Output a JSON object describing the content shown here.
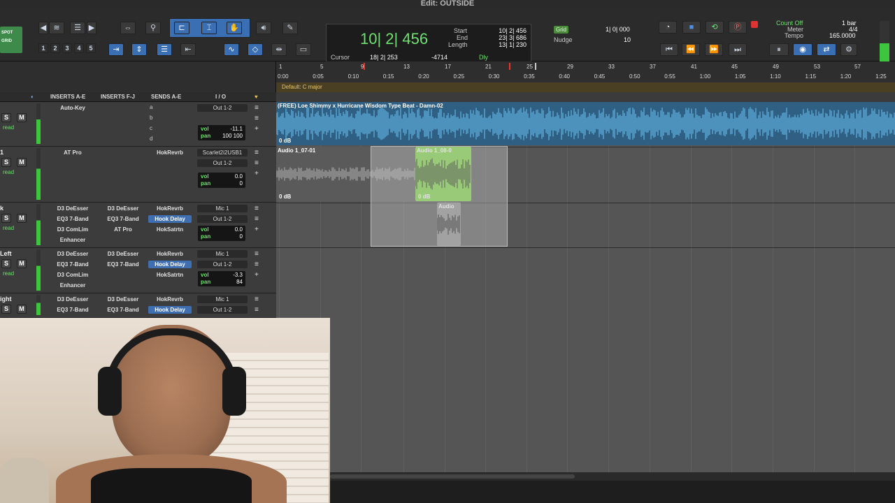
{
  "window": {
    "title": "Edit: OUTSIDE"
  },
  "toolbar": {
    "mode_spot": "SPOT",
    "mode_grid": "GRID",
    "zoom_presets": [
      "1",
      "2",
      "3",
      "4",
      "5"
    ]
  },
  "counter": {
    "main": "10| 2| 456",
    "start_label": "Start",
    "start_value": "10| 2| 456",
    "end_label": "End",
    "end_value": "23| 3| 686",
    "length_label": "Length",
    "length_value": "13| 1| 230",
    "cursor_label": "Cursor",
    "cursor_value": "18| 2| 253",
    "cursor_db": "-4714",
    "dly_label": "Dly"
  },
  "grid": {
    "label": "Grid",
    "value": "1| 0| 000",
    "nudge_label": "Nudge",
    "nudge_value": "10"
  },
  "meter": {
    "count_off": "Count Off",
    "meter_label": "Meter",
    "tempo_label": "Tempo",
    "bar": "1 bar",
    "sig": "4/4",
    "tempo": "165.0000"
  },
  "ruler": {
    "bars": [
      "1",
      "5",
      "9",
      "13",
      "17",
      "21",
      "25",
      "29",
      "33",
      "37",
      "41",
      "45",
      "49",
      "53",
      "57"
    ],
    "times": [
      "0:00",
      "0:05",
      "0:10",
      "0:15",
      "0:20",
      "0:25",
      "0:30",
      "0:35",
      "0:40",
      "0:45",
      "0:50",
      "0:55",
      "1:00",
      "1:05",
      "1:10",
      "1:15",
      "1:20",
      "1:25"
    ],
    "key": "Default: C major"
  },
  "columns": {
    "inserts_ae": "INSERTS A-E",
    "inserts_fj": "INSERTS F-J",
    "sends_ae": "SENDS A-E",
    "io": "I / O"
  },
  "mix_rows": [
    {
      "name": "",
      "ins_a": [
        "Auto-Key"
      ],
      "ins_b": [],
      "send": [
        "a",
        "b",
        "c",
        "d"
      ],
      "io": [
        "Out 1-2"
      ],
      "vol": "-11.1",
      "pan": "100  100",
      "rec": "read"
    },
    {
      "name": "1",
      "ins_a": [
        "AT Pro"
      ],
      "ins_b": [],
      "send_names": [
        "HokRevrb"
      ],
      "io": [
        "Scarlet2i2USB1",
        "Out 1-2"
      ],
      "vol": "0.0",
      "pan": "0",
      "rec": "read"
    },
    {
      "name": "k",
      "ins_a": [
        "D3 DeEsser",
        "EQ3 7-Band",
        "D3 ComLim",
        "Enhancer"
      ],
      "ins_b": [
        "D3 DeEsser",
        "EQ3 7-Band",
        "AT Pro"
      ],
      "send_names": [
        "HokRevrb",
        "Hook Delay",
        "HokSatrtn"
      ],
      "io": [
        "Mic 1",
        "Out 1-2"
      ],
      "vol": "0.0",
      "pan": "0",
      "rec": "read"
    },
    {
      "name": "Left",
      "ins_a": [
        "D3 DeEsser",
        "EQ3 7-Band",
        "D3 ComLim",
        "Enhancer"
      ],
      "ins_b": [
        "D3 DeEsser",
        "EQ3 7-Band"
      ],
      "send_names": [
        "HokRevrb",
        "Hook Delay",
        "HokSatrtn"
      ],
      "io": [
        "Mic 1",
        "Out 1-2"
      ],
      "vol": "-3.3",
      "pan": "84",
      "rec": "read"
    },
    {
      "name": "ight",
      "ins_a": [
        "D3 DeEsser",
        "EQ3 7-Band"
      ],
      "ins_b": [
        "D3 DeEsser",
        "EQ3 7-Band"
      ],
      "send_names": [
        "HokRevrb",
        "Hook Delay"
      ],
      "io": [
        "Mic 1",
        "Out 1-2"
      ],
      "vol": "",
      "pan": "",
      "rec": ""
    }
  ],
  "clips": {
    "beat": "(FREE) Loe Shimmy x Hurricane Wisdom Type Beat - Damn-02",
    "audio1": "Audio 1_07-01",
    "audio2": "Audio 1_08-0",
    "audio3": "Audio",
    "gain": "0 dB"
  },
  "colors": {
    "accent_green": "#6fe06f",
    "clip_blue": "#5aa9d6",
    "clip_green": "#7bd43e"
  }
}
